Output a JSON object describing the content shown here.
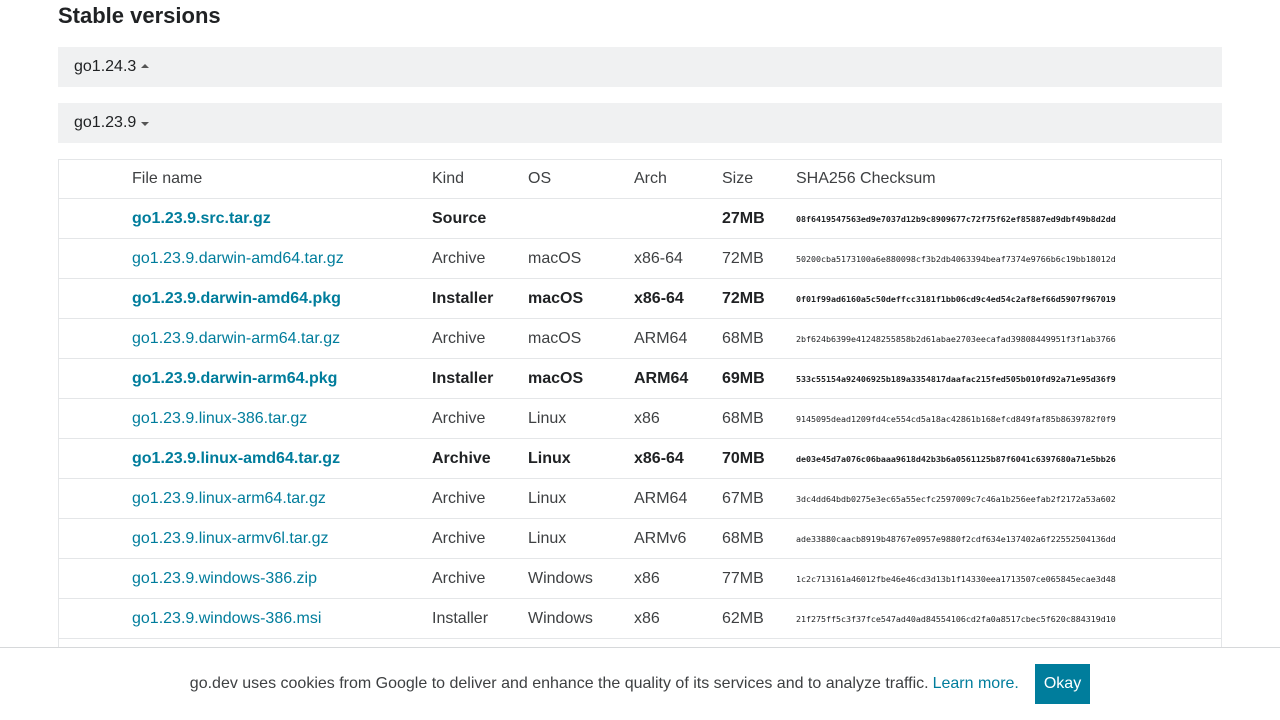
{
  "section": {
    "title": "Stable versions"
  },
  "versions": [
    {
      "label": "go1.24.3",
      "expanded": false
    },
    {
      "label": "go1.23.9",
      "expanded": true
    }
  ],
  "table": {
    "headers": {
      "filename": "File name",
      "kind": "Kind",
      "os": "OS",
      "arch": "Arch",
      "size": "Size",
      "checksum": "SHA256 Checksum"
    },
    "rows": [
      {
        "filename": "go1.23.9.src.tar.gz",
        "kind": "Source",
        "os": "",
        "arch": "",
        "size": "27MB",
        "checksum": "08f6419547563ed9e7037d12b9c8909677c72f75f62ef85887ed9dbf49b8d2dd",
        "highlight": true
      },
      {
        "filename": "go1.23.9.darwin-amd64.tar.gz",
        "kind": "Archive",
        "os": "macOS",
        "arch": "x86-64",
        "size": "72MB",
        "checksum": "50200cba5173100a6e880098cf3b2db4063394beaf7374e9766b6c19bb18012d",
        "highlight": false
      },
      {
        "filename": "go1.23.9.darwin-amd64.pkg",
        "kind": "Installer",
        "os": "macOS",
        "arch": "x86-64",
        "size": "72MB",
        "checksum": "0f01f99ad6160a5c50deffcc3181f1bb06cd9c4ed54c2af8ef66d5907f967019",
        "highlight": true
      },
      {
        "filename": "go1.23.9.darwin-arm64.tar.gz",
        "kind": "Archive",
        "os": "macOS",
        "arch": "ARM64",
        "size": "68MB",
        "checksum": "2bf624b6399e41248255858b2d61abae2703eecafad39808449951f3f1ab3766",
        "highlight": false
      },
      {
        "filename": "go1.23.9.darwin-arm64.pkg",
        "kind": "Installer",
        "os": "macOS",
        "arch": "ARM64",
        "size": "69MB",
        "checksum": "533c55154a92406925b189a3354817daafac215fed505b010fd92a71e95d36f9",
        "highlight": true
      },
      {
        "filename": "go1.23.9.linux-386.tar.gz",
        "kind": "Archive",
        "os": "Linux",
        "arch": "x86",
        "size": "68MB",
        "checksum": "9145095dead1209fd4ce554cd5a18ac42861b168efcd849faf85b8639782f0f9",
        "highlight": false
      },
      {
        "filename": "go1.23.9.linux-amd64.tar.gz",
        "kind": "Archive",
        "os": "Linux",
        "arch": "x86-64",
        "size": "70MB",
        "checksum": "de03e45d7a076c06baaa9618d42b3b6a0561125b87f6041c6397680a71e5bb26",
        "highlight": true
      },
      {
        "filename": "go1.23.9.linux-arm64.tar.gz",
        "kind": "Archive",
        "os": "Linux",
        "arch": "ARM64",
        "size": "67MB",
        "checksum": "3dc4dd64bdb0275e3ec65a55ecfc2597009c7c46a1b256eefab2f2172a53a602",
        "highlight": false
      },
      {
        "filename": "go1.23.9.linux-armv6l.tar.gz",
        "kind": "Archive",
        "os": "Linux",
        "arch": "ARMv6",
        "size": "68MB",
        "checksum": "ade33880caacb8919b48767e0957e9880f2cdf634e137402a6f22552504136dd",
        "highlight": false
      },
      {
        "filename": "go1.23.9.windows-386.zip",
        "kind": "Archive",
        "os": "Windows",
        "arch": "x86",
        "size": "77MB",
        "checksum": "1c2c713161a46012fbe46e46cd3d13b1f14330eea1713507ce065845ecae3d48",
        "highlight": false
      },
      {
        "filename": "go1.23.9.windows-386.msi",
        "kind": "Installer",
        "os": "Windows",
        "arch": "x86",
        "size": "62MB",
        "checksum": "21f275ff5c3f37fce547ad40ad84554106cd2fa0a8517cbec5f620c884319d10",
        "highlight": false
      },
      {
        "filename": "",
        "kind": "",
        "os": "",
        "arch": "",
        "size": "",
        "checksum": "",
        "highlight": false
      }
    ]
  },
  "cookie_bar": {
    "text": "go.dev uses cookies from Google to deliver and enhance the quality of its services and to analyze traffic.",
    "learn_more": "Learn more.",
    "okay": "Okay"
  },
  "colors": {
    "link": "#007d9c",
    "toggle_bg": "#f0f1f2",
    "button_bg": "#007d9c"
  }
}
